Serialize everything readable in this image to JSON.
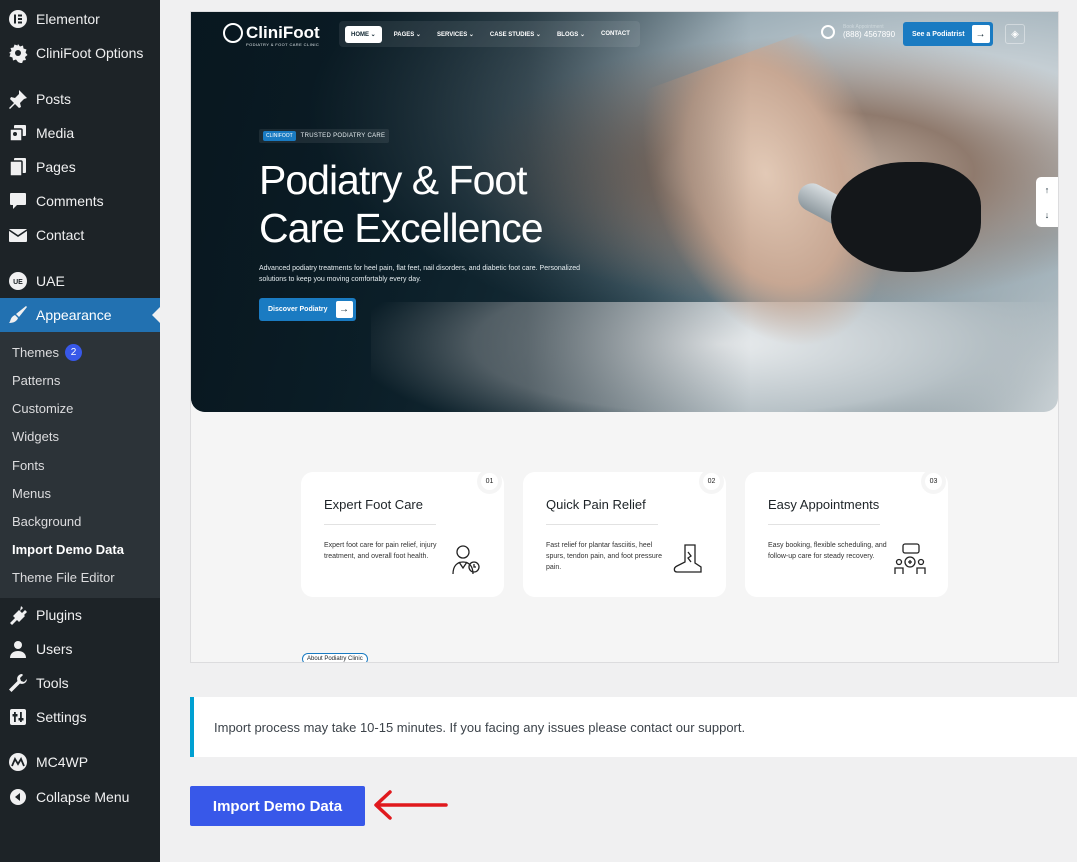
{
  "sidebar": {
    "items": [
      {
        "label": "Elementor",
        "icon": "elementor-icon"
      },
      {
        "label": "CliniFoot Options",
        "icon": "gear-icon"
      },
      {
        "label": "Posts",
        "icon": "pin-icon"
      },
      {
        "label": "Media",
        "icon": "media-icon"
      },
      {
        "label": "Pages",
        "icon": "pages-icon"
      },
      {
        "label": "Comments",
        "icon": "comment-icon"
      },
      {
        "label": "Contact",
        "icon": "mail-icon"
      },
      {
        "label": "UAE",
        "icon": "uae-icon"
      },
      {
        "label": "Appearance",
        "icon": "brush-icon"
      },
      {
        "label": "Plugins",
        "icon": "plug-icon"
      },
      {
        "label": "Users",
        "icon": "user-icon"
      },
      {
        "label": "Tools",
        "icon": "wrench-icon"
      },
      {
        "label": "Settings",
        "icon": "sliders-icon"
      },
      {
        "label": "MC4WP",
        "icon": "mc4wp-icon"
      },
      {
        "label": "Collapse Menu",
        "icon": "collapse-icon"
      }
    ],
    "appearance_submenu": [
      {
        "label": "Themes",
        "badge": "2"
      },
      {
        "label": "Patterns"
      },
      {
        "label": "Customize"
      },
      {
        "label": "Widgets"
      },
      {
        "label": "Fonts"
      },
      {
        "label": "Menus"
      },
      {
        "label": "Background"
      },
      {
        "label": "Import Demo Data",
        "current": true
      },
      {
        "label": "Theme File Editor"
      }
    ]
  },
  "preview": {
    "logo_name": "CliniFoot",
    "logo_tagline": "PODIATRY & FOOT CARE CLINIC",
    "nav": [
      "HOME",
      "PAGES",
      "SERVICES",
      "CASE STUDIES",
      "BLOGS",
      "CONTACT"
    ],
    "book_label": "Book Appointment",
    "phone": "(888) 4567890",
    "top_cta": "See a Podiatrist",
    "badge_tag": "CLINIFOOT",
    "badge_text": "TRUSTED PODIATRY CARE",
    "headline_line1": "Podiatry & Foot",
    "headline_line2": "Care Excellence",
    "lede": "Advanced podiatry treatments for heel pain, flat feet, nail disorders, and diabetic foot care. Personalized solutions to keep you moving comfortably every day.",
    "hero_cta": "Discover Podiatry",
    "cards": [
      {
        "num": "01",
        "title": "Expert Foot Care",
        "desc": "Expert foot care for pain relief, injury treatment, and overall foot health.",
        "icon": "doctor-icon"
      },
      {
        "num": "02",
        "title": "Quick Pain Relief",
        "desc": "Fast relief for plantar fasciitis, heel spurs, tendon pain, and foot pressure pain.",
        "icon": "foot-pain-icon"
      },
      {
        "num": "03",
        "title": "Easy Appointments",
        "desc": "Easy booking, flexible scheduling, and follow-up care for steady recovery.",
        "icon": "appointment-icon"
      }
    ],
    "about_pill": "About Podiatry Clinic"
  },
  "notice": "Import process may take 10-15 minutes. If you facing any issues please contact our support.",
  "import_button": "Import Demo Data",
  "colors": {
    "accent": "#3858e9",
    "wp_blue": "#2271b1",
    "sidebar": "#1d2327",
    "annotation_arrow": "#e0191d"
  }
}
